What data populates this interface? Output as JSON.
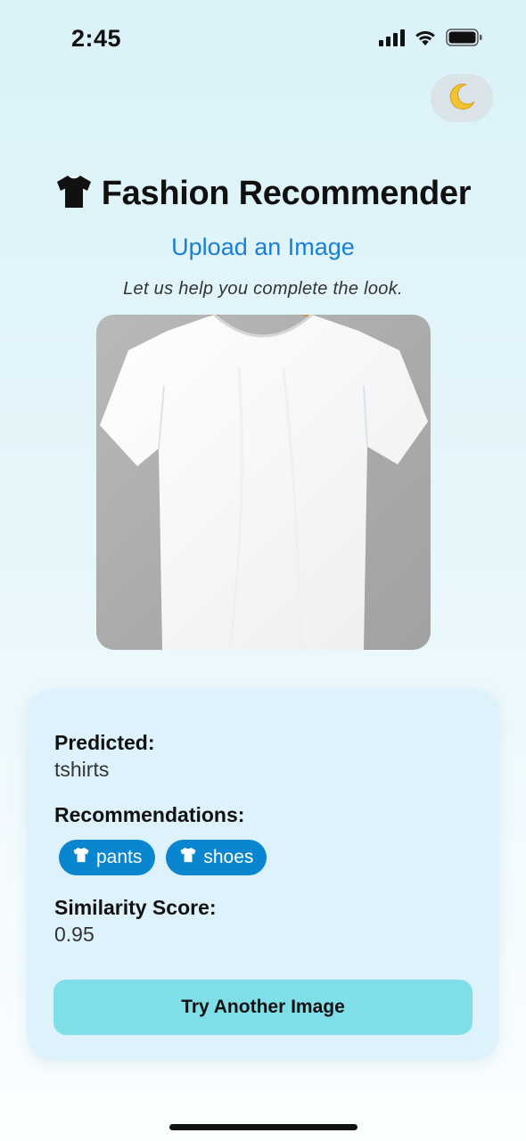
{
  "status_bar": {
    "time": "2:45",
    "icons": [
      "cellular-signal-icon",
      "wifi-icon",
      "battery-icon"
    ]
  },
  "theme_toggle": {
    "icon": "moon-icon",
    "glyph": "🌙"
  },
  "header": {
    "icon": "tshirt-icon",
    "title": "Fashion Recommender",
    "upload_link": "Upload an Image",
    "tagline": "Let us help you complete the look."
  },
  "image": {
    "subject": "white t-shirt on hanger"
  },
  "result": {
    "predicted_label": "Predicted:",
    "predicted_value": "tshirts",
    "recommendations_label": "Recommendations:",
    "recommendations": [
      {
        "icon": "tshirt-icon",
        "label": "pants"
      },
      {
        "icon": "tshirt-icon",
        "label": "shoes"
      }
    ],
    "similarity_label": "Similarity Score:",
    "similarity_value": "0.95",
    "try_button": "Try Another Image"
  },
  "colors": {
    "accent_link": "#1a7fd4",
    "chip_background": "#0a85cf",
    "button_background": "#7fdfe9",
    "card_background": "#ddf2fb"
  }
}
